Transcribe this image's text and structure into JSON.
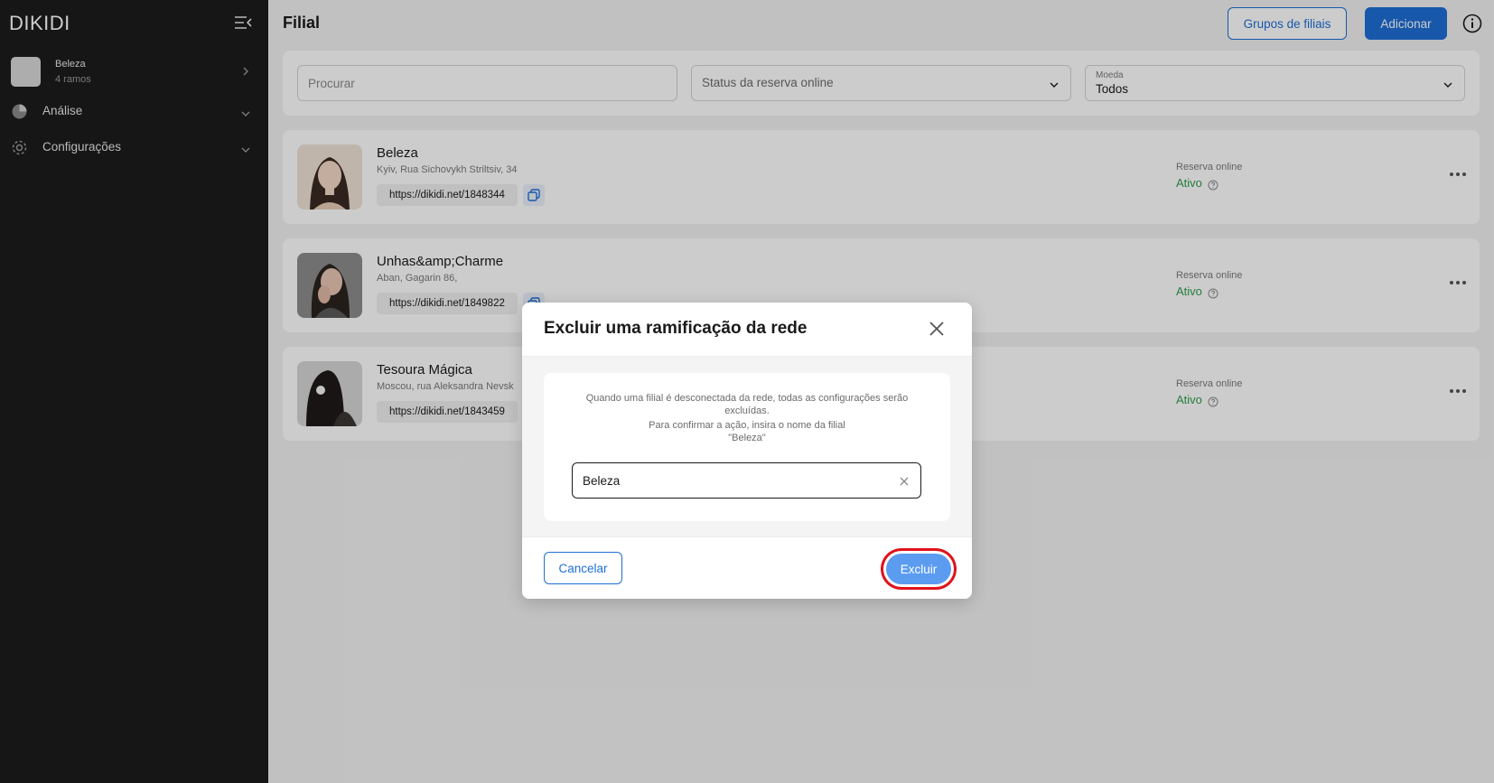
{
  "sidebar": {
    "logo": "DIKIDI",
    "branch": {
      "name": "Beleza",
      "count": "4 ramos"
    },
    "nav": [
      {
        "label": "Análise",
        "icon": "pie-chart-icon"
      },
      {
        "label": "Configurações",
        "icon": "gear-icon"
      }
    ]
  },
  "header": {
    "title": "Filial",
    "groups_button": "Grupos de filiais",
    "add_button": "Adicionar"
  },
  "filters": {
    "search_placeholder": "Procurar",
    "status_placeholder": "Status da reserva online",
    "currency_label": "Moeda",
    "currency_value": "Todos"
  },
  "branches": [
    {
      "name": "Beleza",
      "address": "Kyiv, Rua Sichovykh Striltsiv, 34",
      "link": "https://dikidi.net/1848344",
      "reserve_label": "Reserva online",
      "reserve_status": "Ativo"
    },
    {
      "name": "Unhas&amp;Charme",
      "address": "Aban, Gagarin 86,",
      "link": "https://dikidi.net/1849822",
      "reserve_label": "Reserva online",
      "reserve_status": "Ativo"
    },
    {
      "name": "Tesoura Mágica",
      "address": "Moscou, rua Aleksandra Nevsk",
      "link": "https://dikidi.net/1843459",
      "reserve_label": "Reserva online",
      "reserve_status": "Ativo"
    }
  ],
  "modal": {
    "title": "Excluir uma ramificação da rede",
    "message_line1": "Quando uma filial é desconectada da rede, todas as configurações serão excluídas.",
    "message_line2": "Para confirmar a ação, insira o nome da filial",
    "message_line3": "\"Beleza\"",
    "input_value": "Beleza",
    "cancel_label": "Cancelar",
    "delete_label": "Excluir"
  },
  "colors": {
    "primary": "#1f6fd6",
    "delete_button": "#5b9cf0",
    "highlight": "#e0121b",
    "status_active": "#2e9e4f",
    "sidebar_bg": "#1c1c1c"
  }
}
